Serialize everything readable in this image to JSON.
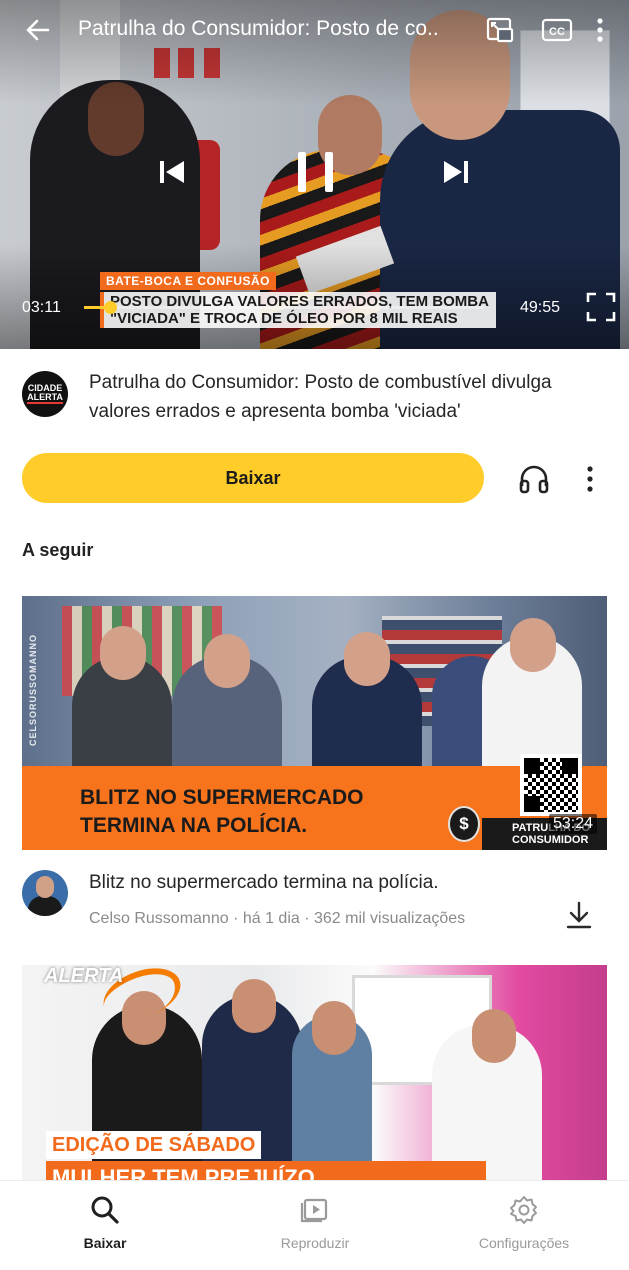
{
  "player": {
    "title": "Patrulha do Consumidor: Posto de co..",
    "current_time": "03:11",
    "duration": "49:55",
    "progress": 0.064,
    "overlay": {
      "kicker": "BATE-BOCA E CONFUSÃO",
      "headline": "POSTO DIVULGA VALORES ERRADOS, TEM BOMBA \"VICIADA\" E TROCA DE ÓLEO POR 8 MIL REAIS"
    }
  },
  "video": {
    "channel_logo_line1": "CIDADE",
    "channel_logo_line2": "ALERTA",
    "title": "Patrulha do Consumidor: Posto de combustível divulga valores errados e apresenta bomba 'viciada'",
    "download_label": "Baixar"
  },
  "up_next_label": "A seguir",
  "up_next": [
    {
      "thumb_headline": "BLITZ NO SUPERMERCADO TERMINA NA POLÍCIA.",
      "thumb_channel": "CELSORUSSOMANNO",
      "thumb_badge": "PATRULHA DO CONSUMIDOR",
      "duration": "53:24",
      "title": "Blitz no supermercado termina na polícia.",
      "meta": "Celso Russomanno · há 1 dia · 362 mil visualizações"
    },
    {
      "thumb_logo": "ALERTA",
      "thumb_kicker": "EDIÇÃO DE SÁBADO",
      "thumb_headline": "MULHER TEM PREJUÍZO"
    }
  ],
  "nav": [
    {
      "label": "Baixar",
      "icon": "search-icon",
      "active": true
    },
    {
      "label": "Reproduzir",
      "icon": "play-library-icon",
      "active": false
    },
    {
      "label": "Configurações",
      "icon": "gear-icon",
      "active": false
    }
  ],
  "colors": {
    "accent": "#ffcc29",
    "news_orange": "#f26b1d",
    "nav_inactive": "#9a9a9a"
  }
}
